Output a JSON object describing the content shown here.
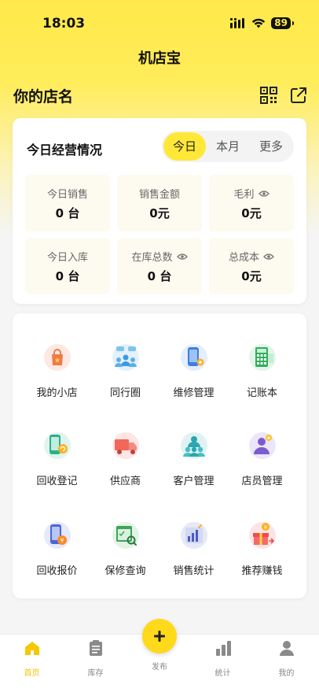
{
  "status": {
    "time": "18:03",
    "battery": "89"
  },
  "nav": {
    "title": "机店宝"
  },
  "shop": {
    "name": "你的店名"
  },
  "overview": {
    "title": "今日经营情况",
    "tabs": [
      "今日",
      "本月",
      "更多"
    ],
    "active_tab": "今日",
    "stats": [
      {
        "label": "今日销售",
        "value": "0 台",
        "has_eye": false
      },
      {
        "label": "销售金额",
        "value": "0元",
        "has_eye": false
      },
      {
        "label": "毛利",
        "value": "0元",
        "has_eye": true
      },
      {
        "label": "今日入库",
        "value": "0 台",
        "has_eye": false
      },
      {
        "label": "在库总数",
        "value": "0 台",
        "has_eye": true
      },
      {
        "label": "总成本",
        "value": "0元",
        "has_eye": true
      }
    ]
  },
  "menu": {
    "items": [
      {
        "label": "我的小店",
        "icon": "shopping-bag-icon"
      },
      {
        "label": "同行圈",
        "icon": "peer-circle-icon"
      },
      {
        "label": "维修管理",
        "icon": "repair-phone-icon"
      },
      {
        "label": "记账本",
        "icon": "calculator-icon"
      },
      {
        "label": "回收登记",
        "icon": "recycle-phone-icon"
      },
      {
        "label": "供应商",
        "icon": "truck-icon"
      },
      {
        "label": "客户管理",
        "icon": "customers-icon"
      },
      {
        "label": "店员管理",
        "icon": "staff-icon"
      },
      {
        "label": "回收报价",
        "icon": "price-phone-icon"
      },
      {
        "label": "保修查询",
        "icon": "warranty-search-icon"
      },
      {
        "label": "销售统计",
        "icon": "sales-chart-icon"
      },
      {
        "label": "推荐赚钱",
        "icon": "gift-icon"
      }
    ]
  },
  "tabbar": {
    "items": [
      {
        "label": "首页",
        "icon": "home-icon"
      },
      {
        "label": "库存",
        "icon": "clipboard-icon"
      },
      {
        "label": "发布",
        "icon": "plus-icon"
      },
      {
        "label": "统计",
        "icon": "bar-chart-icon"
      },
      {
        "label": "我的",
        "icon": "user-icon"
      }
    ],
    "active": "首页",
    "accent": "#f0c400"
  },
  "colors": {
    "brand_yellow": "#ffe838",
    "fab_yellow": "#ffd91a"
  }
}
